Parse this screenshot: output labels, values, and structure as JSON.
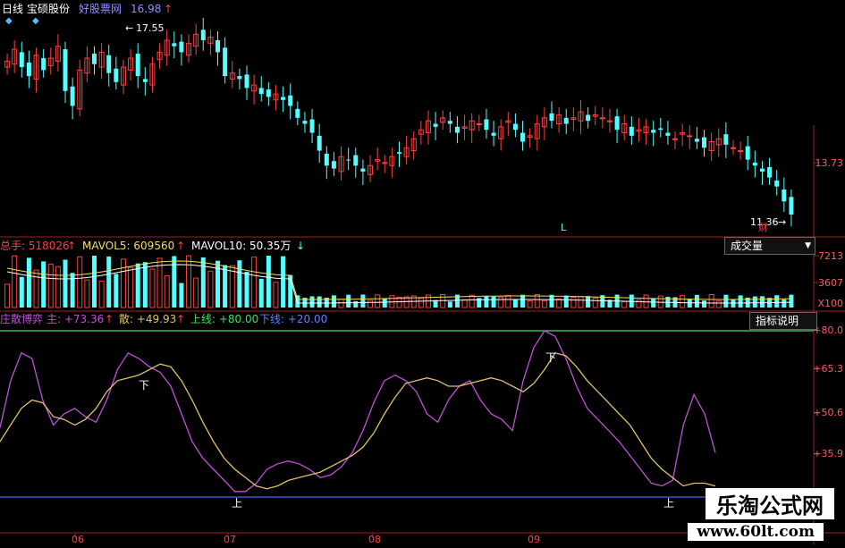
{
  "header": {
    "period": "日线",
    "stock_name": "宝硕股份",
    "formula_name": "好股票网",
    "formula_value": "16.98"
  },
  "price_panel": {
    "high_annotation": "17.55",
    "low_annotation": "11.36",
    "axis_label": "13.73",
    "marker_l": "L",
    "marker_cai": "财"
  },
  "volume_panel": {
    "vol_label": "总手: 518026",
    "mavol5_label": "MAVOL5: 609560",
    "mavol10_label": "MAVOL10: 50.35万",
    "dropdown_label": "成交量",
    "axis_labels": [
      "7213",
      "3607",
      "X100"
    ]
  },
  "indicator_panel": {
    "name": "庄散博弈",
    "zhu_label": "主: +73.36",
    "san_label": "散: +49.93",
    "upper_label": "上线: +80.00",
    "lower_label": "下线: +20.00",
    "explain_button": "指标说明",
    "axis_labels": [
      "+80.0",
      "+65.3",
      "+50.6",
      "+35.9"
    ],
    "marker_down": "下",
    "marker_up": "上"
  },
  "date_axis": [
    "06",
    "07",
    "08",
    "09"
  ],
  "watermark": {
    "title": "乐淘公式网",
    "url": "www.60lt.com"
  },
  "colors": {
    "up": "#ff4040",
    "down": "#54ffff",
    "main_line": "#c050d8",
    "retail_line": "#e0c070",
    "upper_line": "#40e060",
    "lower_line": "#5060ff"
  },
  "chart_data": [
    {
      "type": "candlestick",
      "title": "宝硕股份",
      "close": [
        16.5,
        16.9,
        16.3,
        16.0,
        16.7,
        16.2,
        16.6,
        17.0,
        15.5,
        15.0,
        16.2,
        16.6,
        16.4,
        16.8,
        16.1,
        15.8,
        16.3,
        16.6,
        16.0,
        15.8,
        16.4,
        16.8,
        17.2,
        17.0,
        16.8,
        17.1,
        17.4,
        17.2,
        17.3,
        16.8,
        16.0,
        16.1,
        15.9,
        15.6,
        15.7,
        15.4,
        15.3,
        15.4,
        15.2,
        15.0,
        14.6,
        14.4,
        14.1,
        13.5,
        13.0,
        12.9,
        13.3,
        13.2,
        13.0,
        12.8,
        13.0,
        13.2,
        13.1,
        13.3,
        13.4,
        13.6,
        13.9,
        14.2,
        14.5,
        14.3,
        14.6,
        14.4,
        14.1,
        14.3,
        14.5,
        14.4,
        14.2,
        14.0,
        14.3,
        14.5,
        14.2,
        13.8,
        14.0,
        14.4,
        14.6,
        14.5,
        14.7,
        14.4,
        14.6,
        14.8,
        14.5,
        14.7,
        14.6,
        14.5,
        14.2,
        14.4,
        14.0,
        14.2,
        14.3,
        14.1,
        14.2,
        14.0,
        13.9,
        14.1,
        14.0,
        13.8,
        13.6,
        13.8,
        13.9,
        13.7,
        13.6,
        13.5,
        13.2,
        13.0,
        12.8,
        12.6,
        12.3,
        11.8,
        11.36
      ],
      "high_annotation": 17.55,
      "low_annotation": 11.36
    },
    {
      "type": "bar",
      "title": "成交量",
      "series": [
        {
          "name": "总手",
          "values": []
        },
        {
          "name": "MAVOL5",
          "values": []
        },
        {
          "name": "MAVOL10",
          "values": []
        }
      ],
      "ylim": [
        0,
        7213
      ],
      "yticks": [
        "7213",
        "3607"
      ]
    },
    {
      "type": "line",
      "title": "庄散博弈",
      "ylim": [
        20,
        85
      ],
      "yticks": [
        "+80.0",
        "+65.3",
        "+50.6",
        "+35.9"
      ],
      "series": [
        {
          "name": "主",
          "values": [
            45,
            62,
            72,
            70,
            55,
            46,
            50,
            52,
            49,
            47,
            55,
            66,
            72,
            70,
            67,
            65,
            60,
            50,
            40,
            34,
            30,
            26,
            22,
            22,
            25,
            30,
            32,
            33,
            32,
            30,
            27,
            28,
            31,
            36,
            44,
            54,
            62,
            64,
            62,
            58,
            50,
            47,
            55,
            60,
            62,
            55,
            50,
            48,
            44,
            62,
            74,
            80,
            78,
            70,
            60,
            52,
            48,
            44,
            40,
            35,
            30,
            25,
            24,
            26,
            46,
            57,
            50,
            36
          ],
          "current": 73.36
        },
        {
          "name": "散",
          "values": [
            40,
            46,
            52,
            55,
            54,
            49,
            48,
            46,
            48,
            52,
            58,
            62,
            63,
            64,
            66,
            68,
            67,
            62,
            55,
            47,
            40,
            34,
            30,
            27,
            24,
            23,
            24,
            26,
            27,
            28,
            29,
            31,
            33,
            35,
            38,
            43,
            50,
            56,
            61,
            62,
            63,
            62,
            60,
            60,
            61,
            62,
            63,
            62,
            60,
            58,
            61,
            66,
            72,
            71,
            67,
            62,
            58,
            54,
            50,
            46,
            40,
            34,
            30,
            27,
            24,
            25,
            25,
            24
          ],
          "current": 49.93
        },
        {
          "name": "上线",
          "values": [
            80
          ],
          "current": 80.0
        },
        {
          "name": "下线",
          "values": [
            20
          ],
          "current": 20.0
        }
      ]
    }
  ]
}
